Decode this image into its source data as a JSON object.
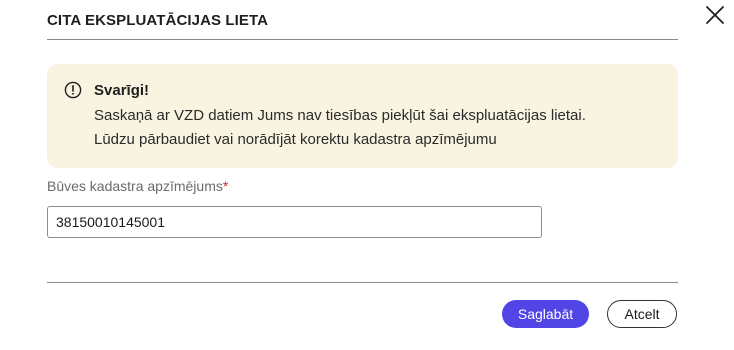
{
  "dialog": {
    "title": "CITA EKSPLUATĀCIJAS LIETA",
    "close_icon": "close-icon"
  },
  "alert": {
    "icon": "info-circle-icon",
    "heading": "Svarīgi!",
    "line1": "Saskaņā ar VZD datiem Jums nav tiesības piekļūt šai ekspluatācijas lietai.",
    "line2": "Lūdzu pārbaudiet vai norādījāt korektu kadastra apzīmējumu",
    "background_color": "#f9f3e1"
  },
  "field": {
    "label": "Būves kadastra apzīmējums",
    "required_marker": "*",
    "value": "38150010145001",
    "placeholder": ""
  },
  "actions": {
    "save_label": "Saglabāt",
    "cancel_label": "Atcelt",
    "accent_color": "#5145e6"
  }
}
